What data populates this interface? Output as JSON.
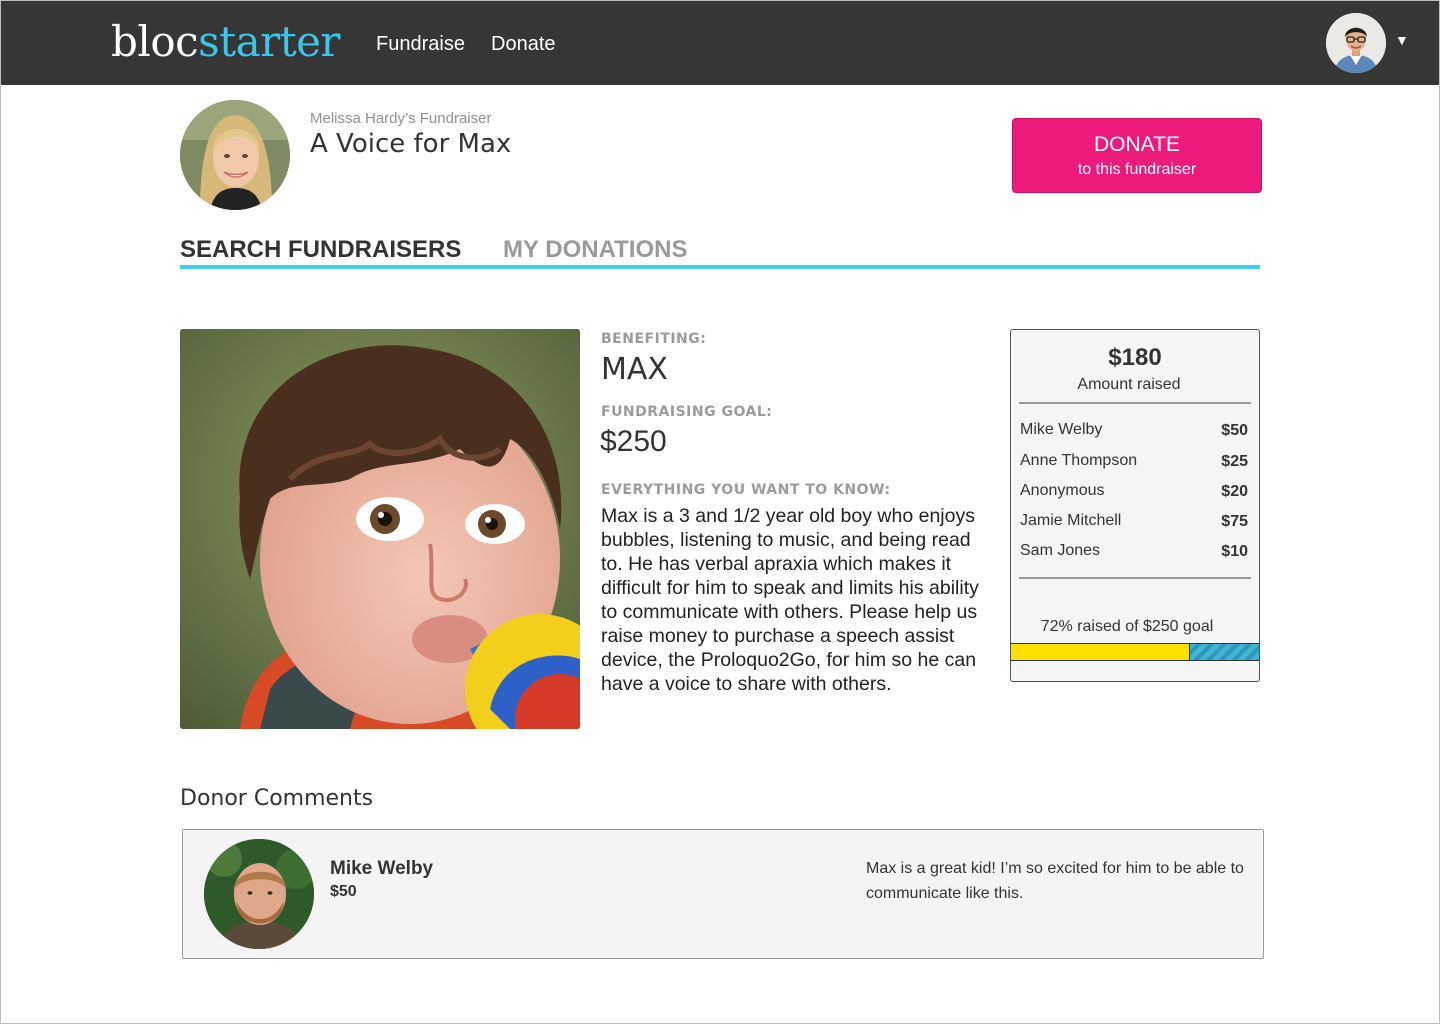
{
  "nav": {
    "logo_part1": "bloc",
    "logo_part2": "starter",
    "links": [
      "Fundraise",
      "Donate"
    ],
    "menu_caret": "▼"
  },
  "header": {
    "owner": "Melissa Hardy’s Fundraiser",
    "title": "A Voice for Max",
    "donate_line1": "DONATE",
    "donate_line2": "to this fundraiser"
  },
  "tabs": [
    {
      "label": "SEARCH FUNDRAISERS",
      "active": true
    },
    {
      "label": "MY DONATIONS",
      "active": false
    }
  ],
  "details": {
    "benefiting_label": "BENEFITING:",
    "benefiting": "MAX",
    "goal_label": "FUNDRAISING GOAL:",
    "goal": "$250",
    "know_label": "EVERYTHING YOU WANT TO KNOW:",
    "description": "Max is a 3 and 1/2 year old boy who enjoys bubbles, listening to music, and being read to. He has verbal apraxia which makes it difficult for him to speak and limits his ability to communicate with others. Please help us raise money to purchase a speech assist device, the Proloquo2Go, for him so he can have a voice to share with others."
  },
  "summary": {
    "amount": "$180",
    "caption": "Amount raised",
    "donations": [
      {
        "name": "Mike Welby",
        "amount": "$50"
      },
      {
        "name": "Anne Thompson",
        "amount": "$25"
      },
      {
        "name": "Anonymous",
        "amount": "$20"
      },
      {
        "name": "Jamie Mitchell",
        "amount": "$75"
      },
      {
        "name": "Sam Jones",
        "amount": "$10"
      }
    ],
    "progress_text": "72% raised of $250 goal",
    "progress_fraction": 0.72
  },
  "comments": {
    "title": "Donor Comments",
    "items": [
      {
        "name": "Mike Welby",
        "amount": "$50",
        "text": "Max is a great kid! I’m so excited for him to be able to communicate like this."
      }
    ]
  },
  "colors": {
    "navbar": "#363636",
    "accent": "#3cc6e8",
    "donate_button": "#ec1b7b",
    "progress_fill": "#ffe100"
  }
}
